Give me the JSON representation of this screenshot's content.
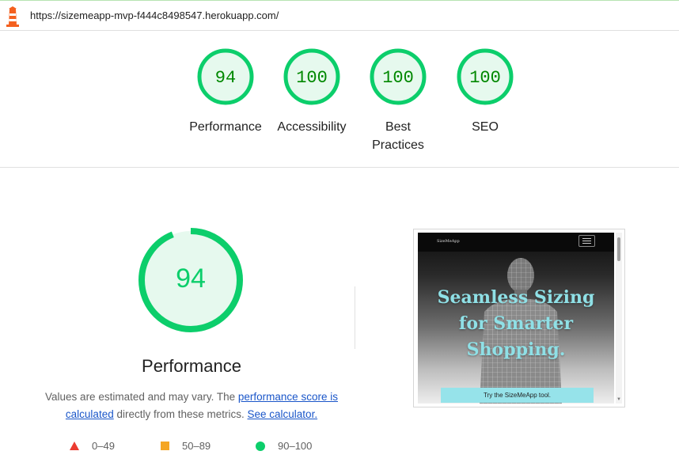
{
  "url_bar": {
    "url": "https://sizemeapp-mvp-f444c8498547.herokuapp.com/"
  },
  "summary": {
    "gauges": [
      {
        "score": "94",
        "label": "Performance"
      },
      {
        "score": "100",
        "label": "Accessibility"
      },
      {
        "score": "100",
        "label": "Best Practices"
      },
      {
        "score": "100",
        "label": "SEO"
      }
    ]
  },
  "performance": {
    "score": "94",
    "score_fraction": 0.94,
    "title": "Performance",
    "desc_prefix": "Values are estimated and may vary. The ",
    "score_link": "performance score is calculated",
    "desc_middle": " directly from these metrics. ",
    "calc_link": "See calculator."
  },
  "legend": [
    {
      "icon": "fail-triangle-icon",
      "range": "0–49"
    },
    {
      "icon": "average-square-icon",
      "range": "50–89"
    },
    {
      "icon": "pass-circle-icon",
      "range": "90–100"
    }
  ],
  "screenshot": {
    "logo": "SizeMeApp",
    "hero_line1": "Seamless Sizing",
    "hero_line2": "for Smarter",
    "hero_line3": "Shopping.",
    "cta": "Try the SizeMeApp tool."
  },
  "colors": {
    "pass": "#0cce6b",
    "pass_bg": "#e6f9ee",
    "pass_text": "#008800",
    "fail": "#eb3b30",
    "average": "#f5a623",
    "link": "#1a56c9"
  }
}
